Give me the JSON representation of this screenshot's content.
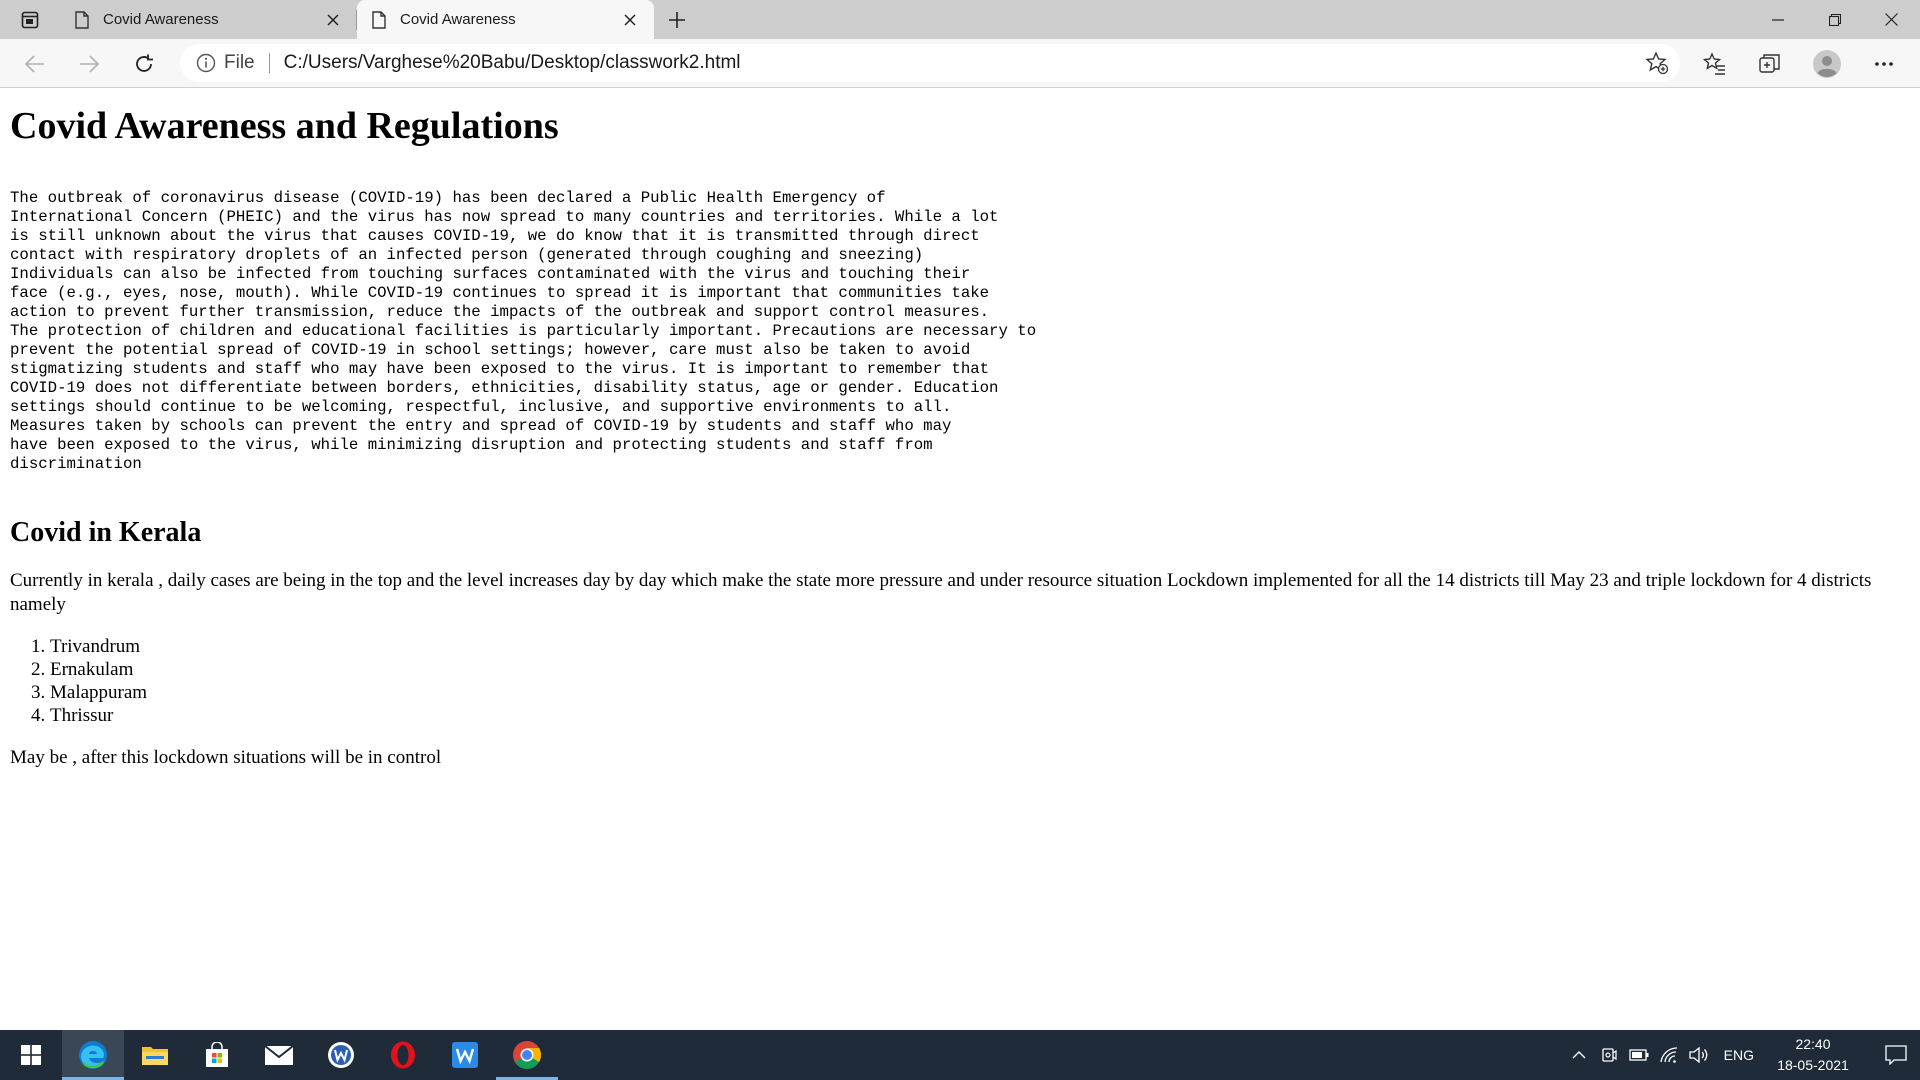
{
  "browser": {
    "tabs": [
      {
        "title": "Covid Awareness",
        "active": false
      },
      {
        "title": "Covid Awareness",
        "active": true
      }
    ],
    "address": {
      "security_label": "File",
      "url": "C:/Users/Varghese%20Babu/Desktop/classwork2.html"
    }
  },
  "page": {
    "title": "Covid Awareness and Regulations",
    "intro_lines": [
      "The outbreak of coronavirus disease (COVID-19) has been declared a Public Health Emergency of",
      "International Concern (PHEIC) and the virus has now spread to many countries and territories. While a lot",
      "is still unknown about the virus that causes COVID-19, we do know that it is transmitted through direct",
      "contact with respiratory droplets of an infected person (generated through coughing and sneezing)",
      "Individuals can also be infected from touching surfaces contaminated with the virus and touching their",
      "face (e.g., eyes, nose, mouth). While COVID-19 continues to spread it is important that communities take",
      "action to prevent further transmission, reduce the impacts of the outbreak and support control measures.",
      "The protection of children and educational facilities is particularly important. Precautions are necessary to",
      "prevent the potential spread of COVID-19 in school settings; however, care must also be taken to avoid",
      "stigmatizing students and staff who may have been exposed to the virus. It is important to remember that",
      "COVID-19 does not differentiate between borders, ethnicities, disability status, age or gender. Education",
      "settings should continue to be welcoming, respectful, inclusive, and supportive environments to all.",
      "Measures taken by schools can prevent the entry and spread of COVID-19 by students and staff who may",
      "have been exposed to the virus, while minimizing disruption and protecting students and staff from",
      "discrimination"
    ],
    "section_title": "Covid in Kerala",
    "kerala_paragraph": "Currently in kerala , daily cases are being in the top and the level increases day by day which make the state more pressure and under resource situation Lockdown implemented for all the 14 districts till May 23 and triple lockdown for 4 districts namely",
    "districts": [
      "Trivandrum",
      "Ernakulam",
      "Malappuram",
      "Thrissur"
    ],
    "closing": "May be , after this lockdown situations will be in control"
  },
  "taskbar": {
    "language": "ENG",
    "time": "22:40",
    "date": "18-05-2021"
  },
  "colors": {
    "taskbar_bg": "#1f2b38",
    "tabstrip_bg": "#cdcdcd",
    "toolbar_bg": "#f7f7f7"
  }
}
